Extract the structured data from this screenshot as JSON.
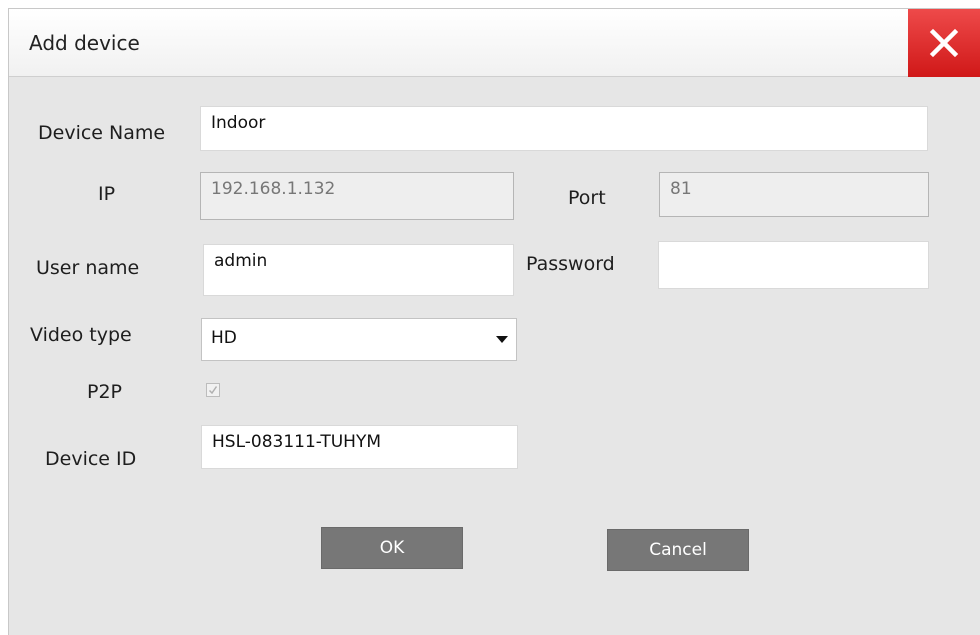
{
  "dialog": {
    "title": "Add device",
    "close_icon": "close-icon",
    "close_color": "#d81c1c"
  },
  "form": {
    "device_name": {
      "label": "Device Name",
      "value": "Indoor"
    },
    "ip": {
      "label": "IP",
      "value": "192.168.1.132"
    },
    "port": {
      "label": "Port",
      "value": "81"
    },
    "user_name": {
      "label": "User name",
      "value": "admin"
    },
    "password": {
      "label": "Password",
      "value": ""
    },
    "video_type": {
      "label": "Video type",
      "value": "HD"
    },
    "p2p": {
      "label": "P2P",
      "checked": true
    },
    "device_id": {
      "label": "Device ID",
      "value": "HSL-083111-TUHYM"
    }
  },
  "buttons": {
    "ok": "OK",
    "cancel": "Cancel"
  }
}
